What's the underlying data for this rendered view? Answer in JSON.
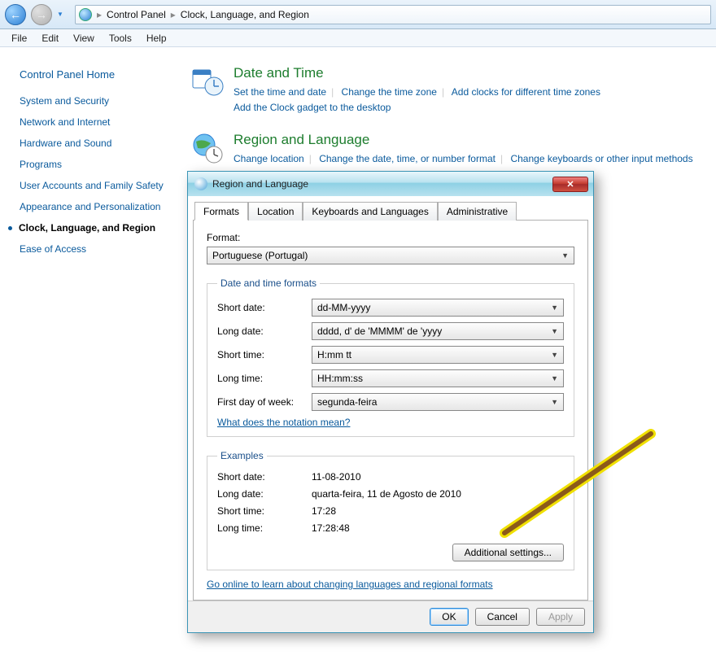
{
  "breadcrumb": {
    "root": "Control Panel",
    "sep": "▸",
    "current": "Clock, Language, and Region"
  },
  "menu": {
    "file": "File",
    "edit": "Edit",
    "view": "View",
    "tools": "Tools",
    "help": "Help"
  },
  "sidebar": {
    "home": "Control Panel Home",
    "items": [
      {
        "label": "System and Security"
      },
      {
        "label": "Network and Internet"
      },
      {
        "label": "Hardware and Sound"
      },
      {
        "label": "Programs"
      },
      {
        "label": "User Accounts and Family Safety"
      },
      {
        "label": "Appearance and Personalization"
      },
      {
        "label": "Clock, Language, and Region"
      },
      {
        "label": "Ease of Access"
      }
    ]
  },
  "sections": {
    "dt": {
      "title": "Date and Time",
      "links": {
        "a": "Set the time and date",
        "b": "Change the time zone",
        "c": "Add clocks for different time zones",
        "d": "Add the Clock gadget to the desktop"
      }
    },
    "rl": {
      "title": "Region and Language",
      "links": {
        "a": "Change location",
        "b": "Change the date, time, or number format",
        "c": "Change keyboards or other input methods"
      }
    }
  },
  "dialog": {
    "title": "Region and Language",
    "tabs": {
      "formats": "Formats",
      "location": "Location",
      "keyboards": "Keyboards and Languages",
      "admin": "Administrative"
    },
    "format_label": "Format:",
    "format_value": "Portuguese (Portugal)",
    "dtf_legend": "Date and time formats",
    "rows": {
      "short_date": {
        "label": "Short date:",
        "value": "dd-MM-yyyy"
      },
      "long_date": {
        "label": "Long date:",
        "value": "dddd, d' de 'MMMM' de 'yyyy"
      },
      "short_time": {
        "label": "Short time:",
        "value": "H:mm tt"
      },
      "long_time": {
        "label": "Long time:",
        "value": "HH:mm:ss"
      },
      "first_day": {
        "label": "First day of week:",
        "value": "segunda-feira"
      }
    },
    "notation_link": "What does the notation mean?",
    "ex_legend": "Examples",
    "examples": {
      "short_date": {
        "label": "Short date:",
        "value": "11-08-2010"
      },
      "long_date": {
        "label": "Long date:",
        "value": "quarta-feira, 11 de Agosto de 2010"
      },
      "short_time": {
        "label": "Short time:",
        "value": "17:28"
      },
      "long_time": {
        "label": "Long time:",
        "value": "17:28:48"
      }
    },
    "additional": "Additional settings...",
    "online_link": "Go online to learn about changing languages and regional formats",
    "ok": "OK",
    "cancel": "Cancel",
    "apply": "Apply"
  }
}
